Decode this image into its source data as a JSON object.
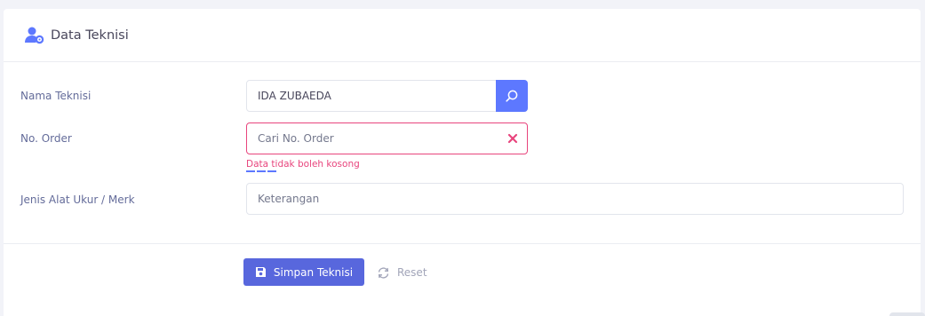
{
  "header": {
    "title": "Data Teknisi",
    "icon": "user-gear-icon"
  },
  "form": {
    "nama_teknisi": {
      "label": "Nama Teknisi",
      "value": "IDA ZUBAEDA",
      "button_icon": "search-icon"
    },
    "no_order": {
      "label": "No. Order",
      "placeholder": "Cari No. Order",
      "value": "",
      "error": "Data tidak boleh kosong",
      "clear_icon": "close-icon"
    },
    "jenis_alat": {
      "label": "Jenis Alat Ukur / Merk",
      "placeholder": "Keterangan",
      "value": ""
    }
  },
  "actions": {
    "save_label": "Simpan Teknisi",
    "save_icon": "save-icon",
    "reset_label": "Reset",
    "reset_icon": "refresh-icon"
  },
  "colors": {
    "primary": "#5d78ff",
    "save": "#5867dd",
    "error": "#e8457d",
    "text": "#646c9a"
  }
}
